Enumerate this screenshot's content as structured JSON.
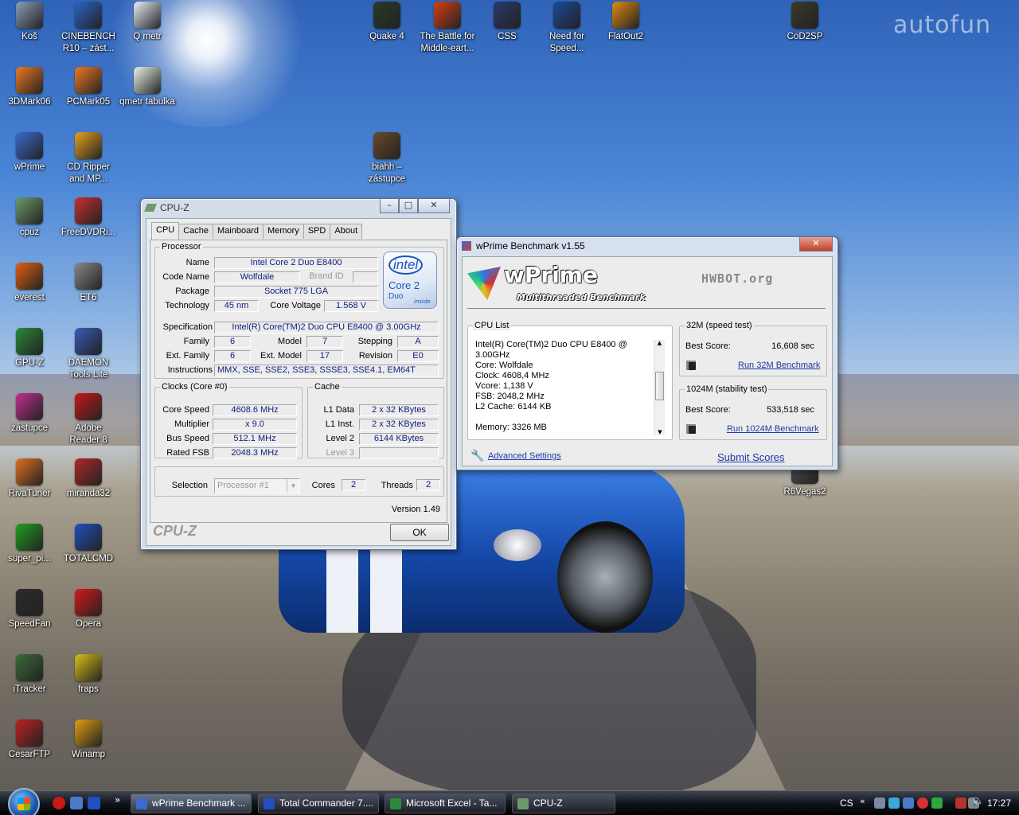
{
  "watermark": "autofun",
  "desktop_icons": [
    {
      "label": "Koš",
      "icon": "recycle-bin-icon",
      "color": "#8aa0b8"
    },
    {
      "label": "CINEBENCH R10 – zást...",
      "icon": "cinebench-icon",
      "color": "#2a64c8"
    },
    {
      "label": "Q metr",
      "icon": "word-document-icon",
      "color": "#e8eef8"
    },
    {
      "label": "3DMark06",
      "icon": "3dmark-icon",
      "color": "#f07820"
    },
    {
      "label": "PCMark05",
      "icon": "pcmark-icon",
      "color": "#f07820"
    },
    {
      "label": "qmetr tabulka",
      "icon": "excel-document-icon",
      "color": "#e8f4e8"
    },
    {
      "label": "wPrime",
      "icon": "wprime-icon",
      "color": "#3c6ad0"
    },
    {
      "label": "CD Ripper and MP...",
      "icon": "cd-ripper-icon",
      "color": "#e8a020"
    },
    {
      "label": "cpuz",
      "icon": "cpuz-icon",
      "color": "#6c9a6c"
    },
    {
      "label": "FreeDVDRi...",
      "icon": "freedvd-icon",
      "color": "#c83030"
    },
    {
      "label": "everest",
      "icon": "everest-icon",
      "color": "#e06010"
    },
    {
      "label": "ET6",
      "icon": "et6-icon",
      "color": "#888"
    },
    {
      "label": "GPU-Z",
      "icon": "gpuz-icon",
      "color": "#2a8a3a"
    },
    {
      "label": "DAEMON Tools Lite",
      "icon": "daemon-tools-icon",
      "color": "#3a5ab8"
    },
    {
      "label": "zástupce",
      "icon": "shortcut-icon",
      "color": "#c03090"
    },
    {
      "label": "Adobe Reader 8",
      "icon": "adobe-reader-icon",
      "color": "#c81818"
    },
    {
      "label": "RivaTuner",
      "icon": "rivatuner-icon",
      "color": "#e07020"
    },
    {
      "label": "miranda32",
      "icon": "miranda-icon",
      "color": "#b02828"
    },
    {
      "label": "super_pi...",
      "icon": "superpi-icon",
      "color": "#20a020"
    },
    {
      "label": "TOTALCMD",
      "icon": "total-commander-icon",
      "color": "#2050c0"
    },
    {
      "label": "SpeedFan",
      "icon": "speedfan-icon",
      "color": "#2b2b2b"
    },
    {
      "label": "Opera",
      "icon": "opera-icon",
      "color": "#d81818"
    },
    {
      "label": "iTracker",
      "icon": "itracker-icon",
      "color": "#3a6a3a"
    },
    {
      "label": "fraps",
      "icon": "fraps-icon",
      "color": "#d8c018"
    },
    {
      "label": "CesarFTP",
      "icon": "cesarftp-icon",
      "color": "#c02020"
    },
    {
      "label": "Winamp",
      "icon": "winamp-icon",
      "color": "#e0a010"
    },
    {
      "label": "Quake 4",
      "icon": "quake4-icon",
      "color": "#2a3a2a"
    },
    {
      "label": "The Battle for Middle-eart...",
      "icon": "battle-middle-earth-icon",
      "color": "#d84010"
    },
    {
      "label": "CSS",
      "icon": "css-game-icon",
      "color": "#2a3a6a"
    },
    {
      "label": "Need for Speed...",
      "icon": "need-for-speed-icon",
      "color": "#1a4a9a"
    },
    {
      "label": "FlatOut2",
      "icon": "flatout2-icon",
      "color": "#e08a10"
    },
    {
      "label": "CoD2SP",
      "icon": "cod2-icon",
      "color": "#3a3a2a"
    },
    {
      "label": "biahh – zástupce",
      "icon": "biahh-icon",
      "color": "#6a4a2a"
    },
    {
      "label": "R6Vegas2",
      "icon": "r6vegas2-icon",
      "color": "#555"
    }
  ],
  "cpuz": {
    "title": "CPU-Z",
    "tabs": [
      "CPU",
      "Cache",
      "Mainboard",
      "Memory",
      "SPD",
      "About"
    ],
    "processor": {
      "group": "Processor",
      "name_label": "Name",
      "name": "Intel Core 2 Duo E8400",
      "codename_label": "Code Name",
      "codename": "Wolfdale",
      "brandid_label": "Brand ID",
      "package_label": "Package",
      "package": "Socket 775 LGA",
      "technology_label": "Technology",
      "technology": "45 nm",
      "voltage_label": "Core Voltage",
      "voltage": "1.568 V",
      "spec_label": "Specification",
      "spec": "Intel(R) Core(TM)2 Duo CPU     E8400  @ 3.00GHz",
      "family_label": "Family",
      "family": "6",
      "model_label": "Model",
      "model": "7",
      "stepping_label": "Stepping",
      "stepping": "A",
      "extfamily_label": "Ext. Family",
      "extfamily": "6",
      "extmodel_label": "Ext. Model",
      "extmodel": "17",
      "revision_label": "Revision",
      "revision": "E0",
      "instructions_label": "Instructions",
      "instructions": "MMX, SSE, SSE2, SSE3, SSSE3, SSE4.1, EM64T",
      "logo_brand": "intel",
      "logo_line1": "Core 2",
      "logo_line2": "Duo",
      "logo_line3": "inside"
    },
    "clocks": {
      "group": "Clocks (Core #0)",
      "core_speed_label": "Core Speed",
      "core_speed": "4608.6 MHz",
      "multiplier_label": "Multiplier",
      "multiplier": "x 9.0",
      "bus_speed_label": "Bus Speed",
      "bus_speed": "512.1 MHz",
      "rated_fsb_label": "Rated FSB",
      "rated_fsb": "2048.3 MHz"
    },
    "cache": {
      "group": "Cache",
      "l1data_label": "L1 Data",
      "l1data": "2 x 32 KBytes",
      "l1inst_label": "L1 Inst.",
      "l1inst": "2 x 32 KBytes",
      "level2_label": "Level 2",
      "level2": "6144 KBytes",
      "level3_label": "Level 3"
    },
    "selection_label": "Selection",
    "selection": "Processor #1",
    "cores_label": "Cores",
    "cores": "2",
    "threads_label": "Threads",
    "threads": "2",
    "version": "Version 1.49",
    "brand": "CPU-Z",
    "ok": "OK"
  },
  "wprime": {
    "title": "wPrime Benchmark v1.55",
    "logo": "wPrime",
    "tagline": "Multithreaded Benchmark",
    "partner": "HWBOT.org",
    "cpu_list_group": "CPU List",
    "cpu_list": [
      "Intel(R) Core(TM)2 Duo CPU     E8400  @",
      "3.00GHz",
      "Core: Wolfdale",
      "Clock: 4608,4 MHz",
      "Vcore: 1,138 V",
      "FSB: 2048,2 MHz",
      "L2 Cache: 6144 KB",
      "",
      "Memory: 3326 MB"
    ],
    "test32_group": "32M (speed test)",
    "best_label": "Best Score:",
    "score32": "16,608 sec",
    "run32": "Run 32M Benchmark",
    "test1024_group": "1024M (stability test)",
    "score1024": "533,518 sec",
    "run1024": "Run 1024M Benchmark",
    "advanced": "Advanced Settings",
    "submit": "Submit Scores"
  },
  "taskbar": {
    "items": [
      {
        "label": "wPrime Benchmark ...",
        "color": "#3c6ad0"
      },
      {
        "label": "Total Commander 7....",
        "color": "#2050c0"
      },
      {
        "label": "Microsoft Excel - Ta...",
        "color": "#2a8a3a"
      },
      {
        "label": "CPU-Z",
        "color": "#6c9a6c"
      }
    ],
    "lang": "CS",
    "clock": "17:27"
  }
}
